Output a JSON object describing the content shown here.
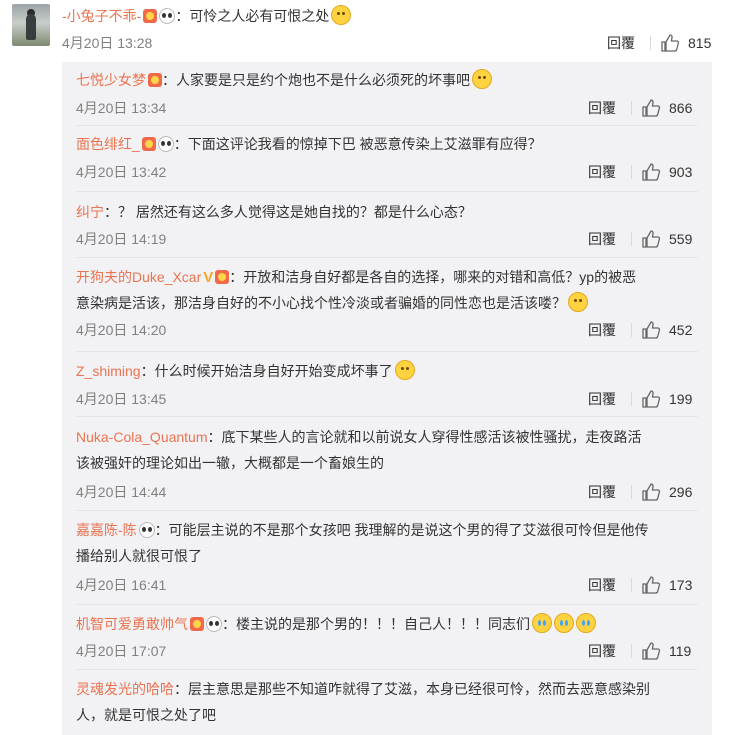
{
  "top": {
    "username": "-小兔子不乖-",
    "text": "：可怜之人必有可恨之处",
    "time": "4月20日 13:28",
    "reply_label": "回覆",
    "likes": "815"
  },
  "replies": [
    {
      "username": "七悦少女梦",
      "line1": "：人家要是只是约个炮也不是什么必须死的坏事吧",
      "line2": "",
      "time": "4月20日 13:34",
      "reply_label": "回覆",
      "likes": "866"
    },
    {
      "username": "面色绯红_",
      "line1": "：下面这评论我看的惊掉下巴 被恶意传染上艾滋罪有应得？",
      "line2": "",
      "time": "4月20日 13:42",
      "reply_label": "回覆",
      "likes": "903"
    },
    {
      "username": "纠宁",
      "line1": "：？ 居然还有这么多人觉得这是她自找的？都是什么心态？",
      "line2": "",
      "time": "4月20日 14:19",
      "reply_label": "回覆",
      "likes": "559"
    },
    {
      "username": "开狗夫的Duke_Xcar",
      "line1": "：开放和洁身自好都是各自的选择，哪来的对错和高低？yp的被恶",
      "line2": "意染病是活该，那洁身自好的不小心找个性冷淡或者骗婚的同性恋也是活该喽？",
      "time": "4月20日 14:20",
      "reply_label": "回覆",
      "likes": "452"
    },
    {
      "username": "Z_shiming",
      "line1": "：什么时候开始洁身自好开始变成坏事了",
      "line2": "",
      "time": "4月20日 13:45",
      "reply_label": "回覆",
      "likes": "199"
    },
    {
      "username": "Nuka-Cola_Quantum",
      "line1": "：底下某些人的言论就和以前说女人穿得性感活该被性骚扰，走夜路活",
      "line2": "该被强奸的理论如出一辙，大概都是一个畜娘生的",
      "time": "4月20日 14:44",
      "reply_label": "回覆",
      "likes": "296"
    },
    {
      "username": "嘉嘉陈-陈",
      "line1": "：可能层主说的不是那个女孩吧 我理解的是说这个男的得了艾滋很可怜但是他传",
      "line2": "播给别人就很可恨了",
      "time": "4月20日 16:41",
      "reply_label": "回覆",
      "likes": "173"
    },
    {
      "username": "机智可爱勇敢帅气",
      "line1": "：楼主说的是那个男的！！！自己人！！！同志们",
      "line2": "",
      "time": "4月20日 17:07",
      "reply_label": "回覆",
      "likes": "119"
    },
    {
      "username": "灵魂发光的哈哈",
      "line1": "：层主意思是那些不知道咋就得了艾滋，本身已经很可怜，然而去恶意感染别",
      "line2": "人，就是可恨之处了吧",
      "time": "",
      "reply_label": "",
      "likes": ""
    }
  ],
  "icons": {
    "like": "thumbs-up-icon",
    "badge": "vip-badge-icon",
    "panda": "panda-badge-icon",
    "emoji": "emoji-icon",
    "verified": "verified-v-icon"
  },
  "colors": {
    "username": "#eb7350",
    "meta": "#808080",
    "reply_bg": "#f2f2f5"
  }
}
